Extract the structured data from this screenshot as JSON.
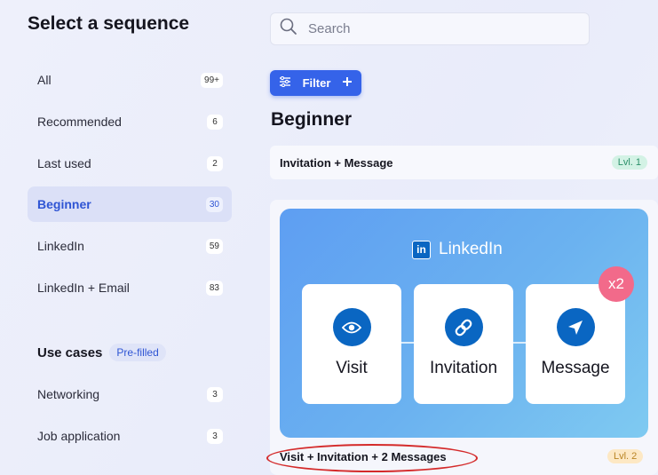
{
  "sidebar": {
    "title": "Select a sequence",
    "items": [
      {
        "label": "All",
        "count": "99+"
      },
      {
        "label": "Recommended",
        "count": "6"
      },
      {
        "label": "Last used",
        "count": "2"
      },
      {
        "label": "Beginner",
        "count": "30",
        "active": true
      },
      {
        "label": "LinkedIn",
        "count": "59"
      },
      {
        "label": "LinkedIn + Email",
        "count": "83"
      }
    ],
    "use_cases": {
      "title": "Use cases",
      "badge": "Pre-filled",
      "items": [
        {
          "label": "Networking",
          "count": "3"
        },
        {
          "label": "Job application",
          "count": "3"
        }
      ]
    }
  },
  "search": {
    "placeholder": "Search",
    "value": "",
    "icon": "search-icon"
  },
  "filter": {
    "label": "Filter",
    "icons": [
      "sliders-icon",
      "plus-icon"
    ]
  },
  "main": {
    "heading": "Beginner",
    "sequences": [
      {
        "title": "Invitation + Message",
        "level": "Lvl. 1"
      },
      {
        "title": "Visit + Invitation + 2 Messages",
        "level": "Lvl. 2",
        "preview": {
          "brand": "LinkedIn",
          "brand_logo": "in",
          "steps": [
            {
              "label": "Visit",
              "icon": "eye-icon"
            },
            {
              "label": "Invitation",
              "icon": "link-icon"
            },
            {
              "label": "Message",
              "icon": "send-icon"
            }
          ],
          "multiplier": "x2"
        }
      }
    ]
  },
  "colors": {
    "accent": "#3563e9",
    "linkedin": "#0a66c2",
    "level1": "#2a8f69",
    "level2": "#b98424",
    "multiplier": "#f26a8a",
    "highlight": "#d42a2a"
  }
}
